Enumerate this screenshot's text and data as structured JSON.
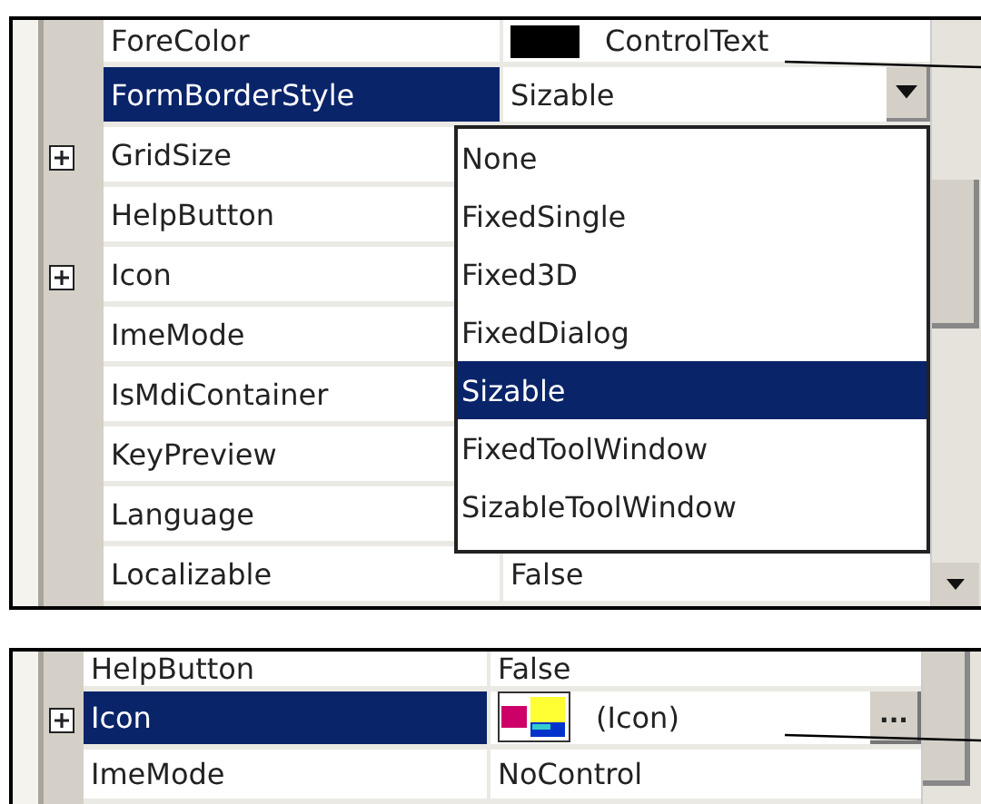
{
  "panels": [
    {
      "rows": [
        {
          "name": "ForeColor",
          "kind": "color",
          "value": "ControlText",
          "color": "#000000",
          "expander": false,
          "selected": false
        },
        {
          "name": "FormBorderStyle",
          "kind": "dropdown",
          "value": "Sizable",
          "expander": false,
          "selected": true
        },
        {
          "name": "GridSize",
          "kind": "hidden",
          "expander": true,
          "selected": false
        },
        {
          "name": "HelpButton",
          "kind": "hidden",
          "expander": false,
          "selected": false
        },
        {
          "name": "Icon",
          "kind": "hidden",
          "expander": true,
          "selected": false
        },
        {
          "name": "ImeMode",
          "kind": "hidden",
          "expander": false,
          "selected": false
        },
        {
          "name": "IsMdiContainer",
          "kind": "hidden",
          "expander": false,
          "selected": false
        },
        {
          "name": "KeyPreview",
          "kind": "hidden",
          "expander": false,
          "selected": false
        },
        {
          "name": "Language",
          "kind": "hidden",
          "expander": false,
          "selected": false
        },
        {
          "name": "Localizable",
          "kind": "plain",
          "value": "False",
          "expander": false,
          "selected": false
        }
      ],
      "dropdown": {
        "options": [
          {
            "label": "None",
            "selected": false
          },
          {
            "label": "FixedSingle",
            "selected": false
          },
          {
            "label": "Fixed3D",
            "selected": false
          },
          {
            "label": "FixedDialog",
            "selected": false
          },
          {
            "label": "Sizable",
            "selected": true
          },
          {
            "label": "FixedToolWindow",
            "selected": false
          },
          {
            "label": "SizableToolWindow",
            "selected": false
          }
        ]
      }
    },
    {
      "rows": [
        {
          "name": "HelpButton",
          "kind": "plain",
          "value": "False",
          "expander": false,
          "selected": false
        },
        {
          "name": "Icon",
          "kind": "icon",
          "value": "(Icon)",
          "button": "...",
          "expander": true,
          "selected": true
        },
        {
          "name": "ImeMode",
          "kind": "plain",
          "value": "NoControl",
          "expander": false,
          "selected": false
        }
      ]
    }
  ]
}
